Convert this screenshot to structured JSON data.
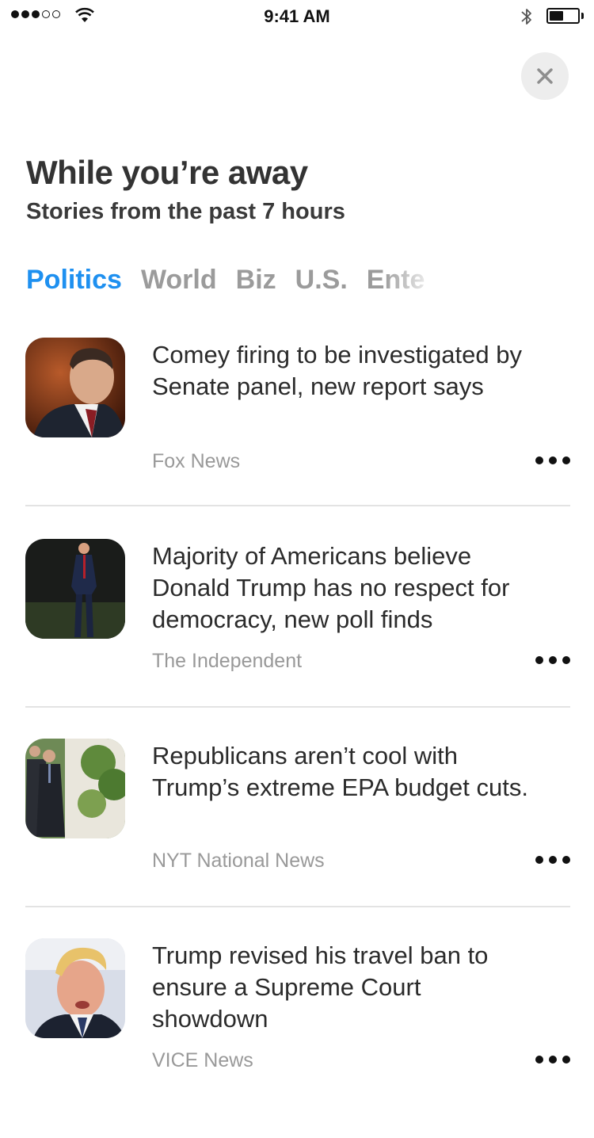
{
  "status_bar": {
    "time": "9:41 AM",
    "signal_bars_filled": 3,
    "signal_bars_total": 5,
    "battery_level": 0.5,
    "wifi_icon": "wifi-icon",
    "bluetooth_icon": "bluetooth-icon"
  },
  "close_icon": "close-icon",
  "header": {
    "title": "While you’re away",
    "subtitle": "Stories from the past 7 hours"
  },
  "tabs": [
    {
      "label": "Politics",
      "active": true
    },
    {
      "label": "World"
    },
    {
      "label": "Biz"
    },
    {
      "label": "U.S."
    },
    {
      "label": "Ente"
    }
  ],
  "colors": {
    "accent": "#1E90F0",
    "tab_inactive": "#9B9B9B",
    "source_text": "#999999"
  },
  "stories": [
    {
      "headline": "Comey firing to be investigated by Senate panel, new report says",
      "source": "Fox News"
    },
    {
      "headline": "Majority of Americans believe Donald Trump has no respect for democracy, new poll finds",
      "source": "The Independent"
    },
    {
      "headline": "Republicans aren’t cool with Trump’s extreme EPA budget cuts.",
      "source": "NYT National News"
    },
    {
      "headline": "Trump revised his travel ban to ensure a Supreme Court showdown",
      "source": "VICE News"
    }
  ]
}
